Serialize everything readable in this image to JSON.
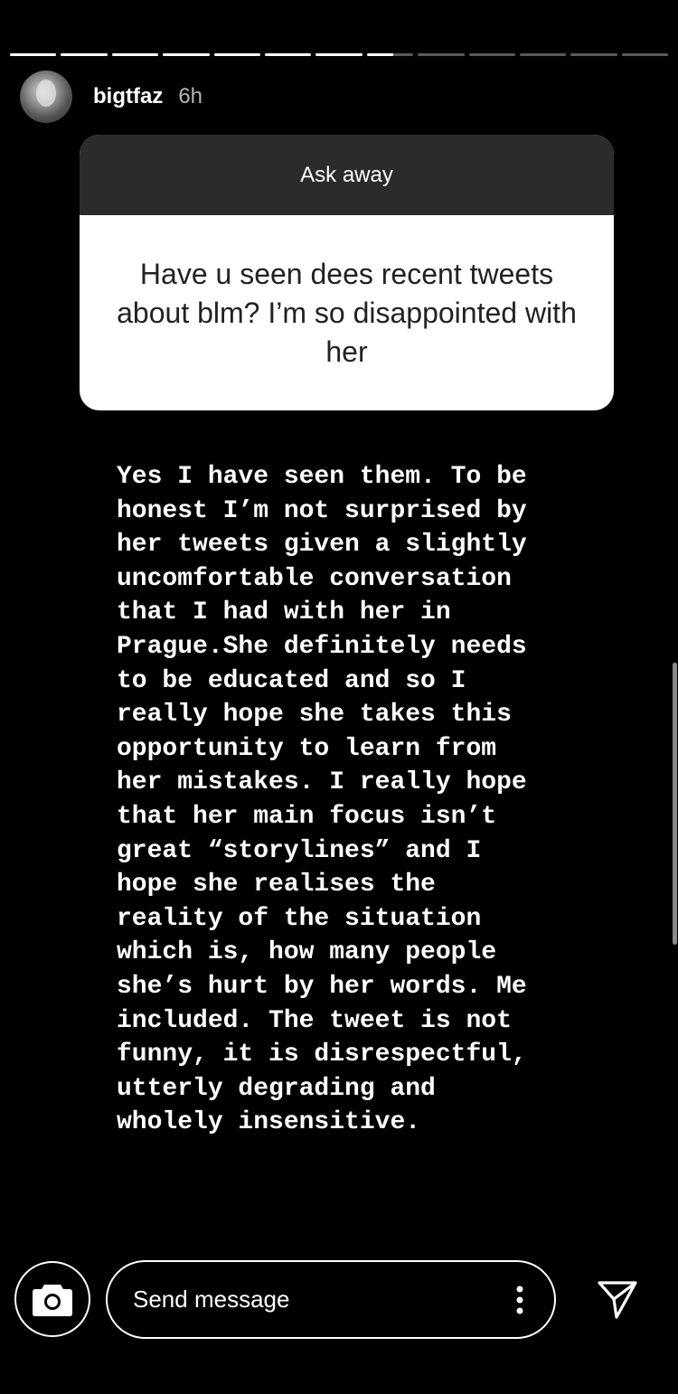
{
  "story": {
    "progress": {
      "total_segments": 13,
      "viewed_fraction": 0.582
    }
  },
  "header": {
    "username": "bigtfaz",
    "time": "6h"
  },
  "question_sticker": {
    "prompt": "Ask away",
    "question": "Have u seen dees recent tweets about blm? I’m so disappointed with her"
  },
  "answer_text": "Yes I have seen them. To be\nhonest I’m not surprised by\nher tweets given a slightly\nuncomfortable conversation\nthat I had with her in\nPrague.She definitely needs\nto be educated and so I\nreally hope she takes this\nopportunity to learn from\nher mistakes. I really hope\nthat her main focus isn’t\ngreat “storylines” and I\nhope she realises the\nreality of the situation\nwhich is, how many people\nshe’s hurt by her words. Me\nincluded. The tweet is not\nfunny, it is disrespectful,\nutterly degrading and\nwholely insensitive.",
  "footer": {
    "message_placeholder": "Send message",
    "icons": {
      "camera": "camera-icon",
      "more": "more-vertical-icon",
      "send": "send-icon"
    }
  },
  "colors": {
    "background": "#000000",
    "sticker_header": "#2b2b2b",
    "sticker_body": "#ffffff",
    "progress_track": "#5a5a5a",
    "progress_fill": "#ffffff"
  }
}
